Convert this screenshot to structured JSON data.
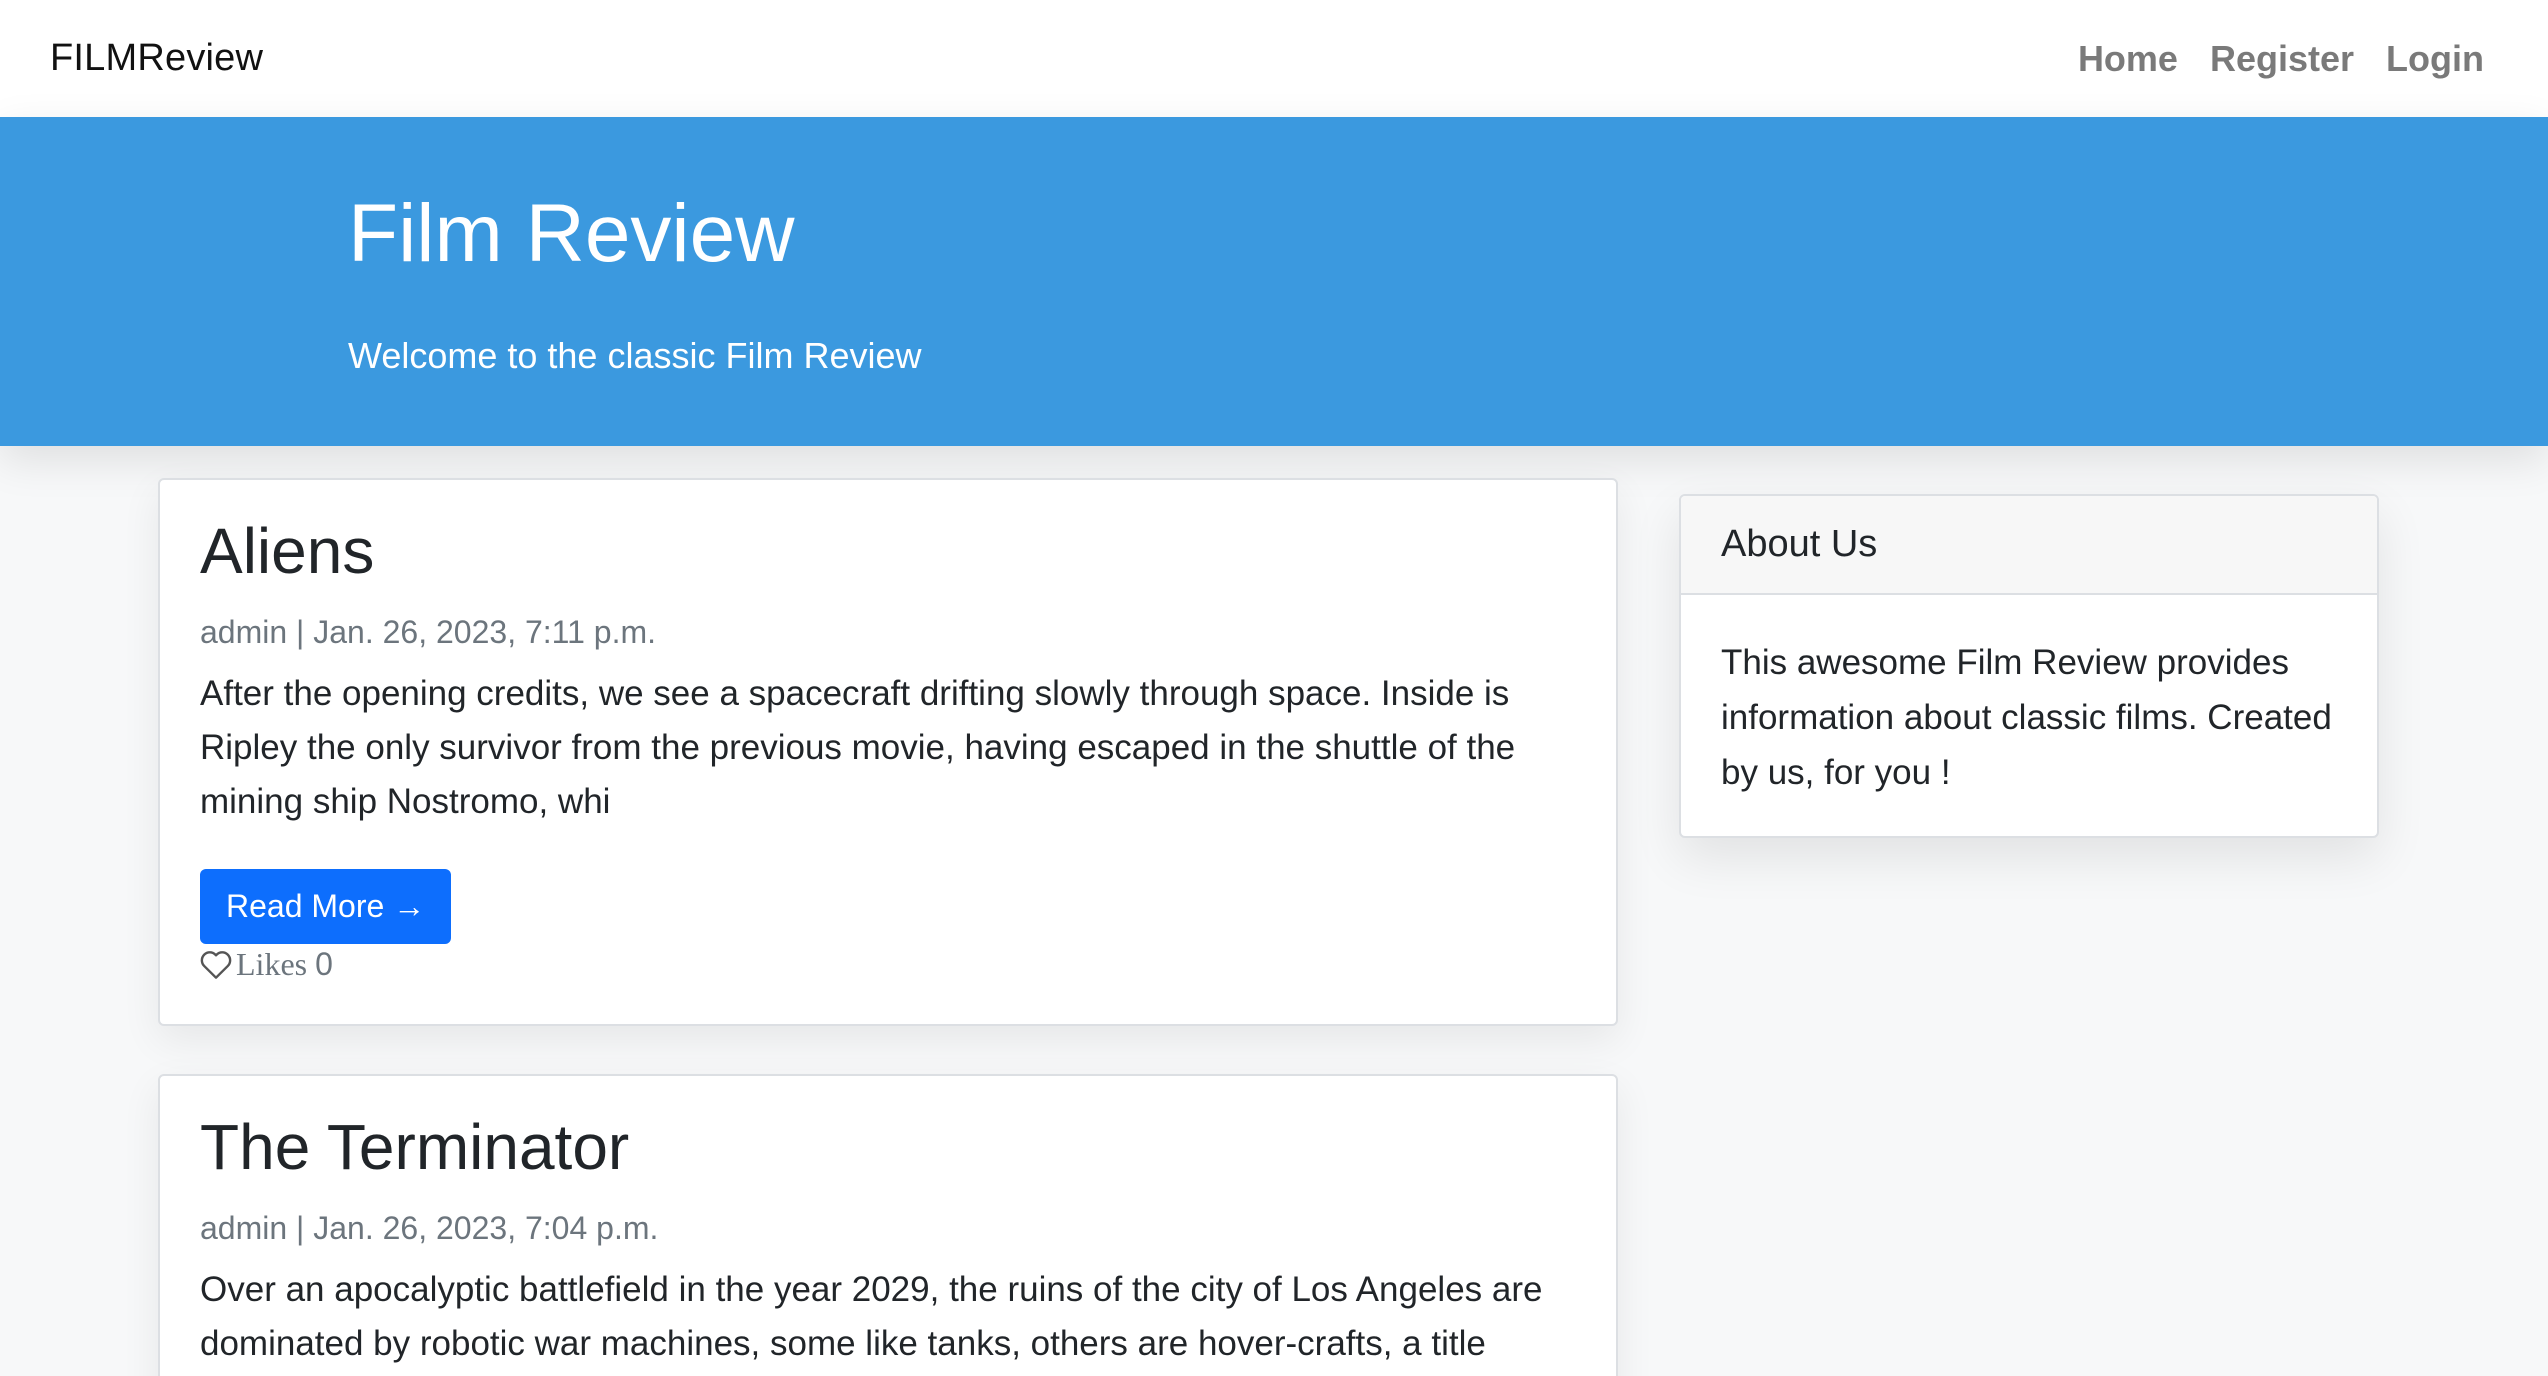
{
  "navbar": {
    "brand": "FILMReview",
    "links": [
      "Home",
      "Register",
      "Login"
    ]
  },
  "hero": {
    "title": "Film Review",
    "subtitle": "Welcome to the classic Film Review"
  },
  "posts": [
    {
      "title": "Aliens",
      "meta": "admin | Jan. 26, 2023, 7:11 p.m.",
      "excerpt": "After the opening credits, we see a spacecraft drifting slowly through space. Inside is Ripley the only survivor from the previous movie, having escaped in the shuttle of the mining ship Nostromo, whi",
      "read_more": "Read More →",
      "likes_label": "Likes",
      "likes_count": "0"
    },
    {
      "title": "The Terminator",
      "meta": "admin | Jan. 26, 2023, 7:04 p.m.",
      "excerpt": "Over an apocalyptic battlefield in the year 2029, the ruins of the city of Los Angeles are dominated by robotic war machines, some like tanks, others are hover-crafts, a title"
    }
  ],
  "sidebar": {
    "title": "About Us",
    "body": "This awesome Film Review provides information about classic films. Created by us, for you !"
  },
  "colors": {
    "hero_bg": "#3b99df",
    "button_bg": "#0d6efd",
    "nav_link": "#7a7a7a"
  },
  "icons": {
    "likes": "heart-outline-icon"
  }
}
